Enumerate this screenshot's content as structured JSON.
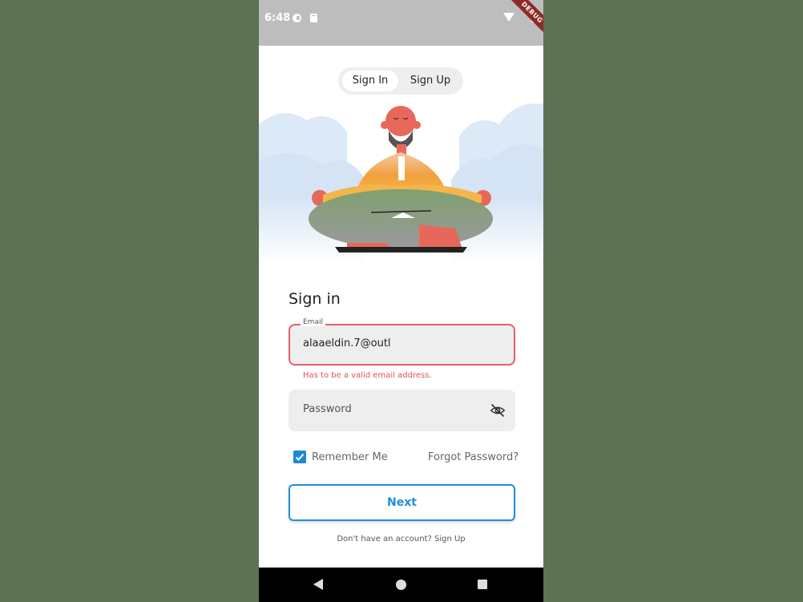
{
  "status_bar": {
    "time": "6:48",
    "debug_label": "DEBUG"
  },
  "auth_tabs": {
    "sign_in": "Sign In",
    "sign_up": "Sign Up",
    "active": "Sign In"
  },
  "form": {
    "title": "Sign in",
    "email": {
      "label": "Email",
      "value": "alaaeldin.7@outl",
      "error": "Has to be a valid email address."
    },
    "password": {
      "placeholder": "Password",
      "icon": "eye-off-icon"
    },
    "remember_me": {
      "label": "Remember Me",
      "checked": true
    },
    "forgot_password": "Forgot Password?",
    "next_button": "Next",
    "signup_prompt": "Don't have an account? Sign Up"
  },
  "nav_bar": {
    "back_icon": "back-icon",
    "home_icon": "home-icon",
    "recents_icon": "recents-icon"
  },
  "colors": {
    "accent": "#1e90d6",
    "error": "#e0606a",
    "outer_background": "#5e7155"
  }
}
